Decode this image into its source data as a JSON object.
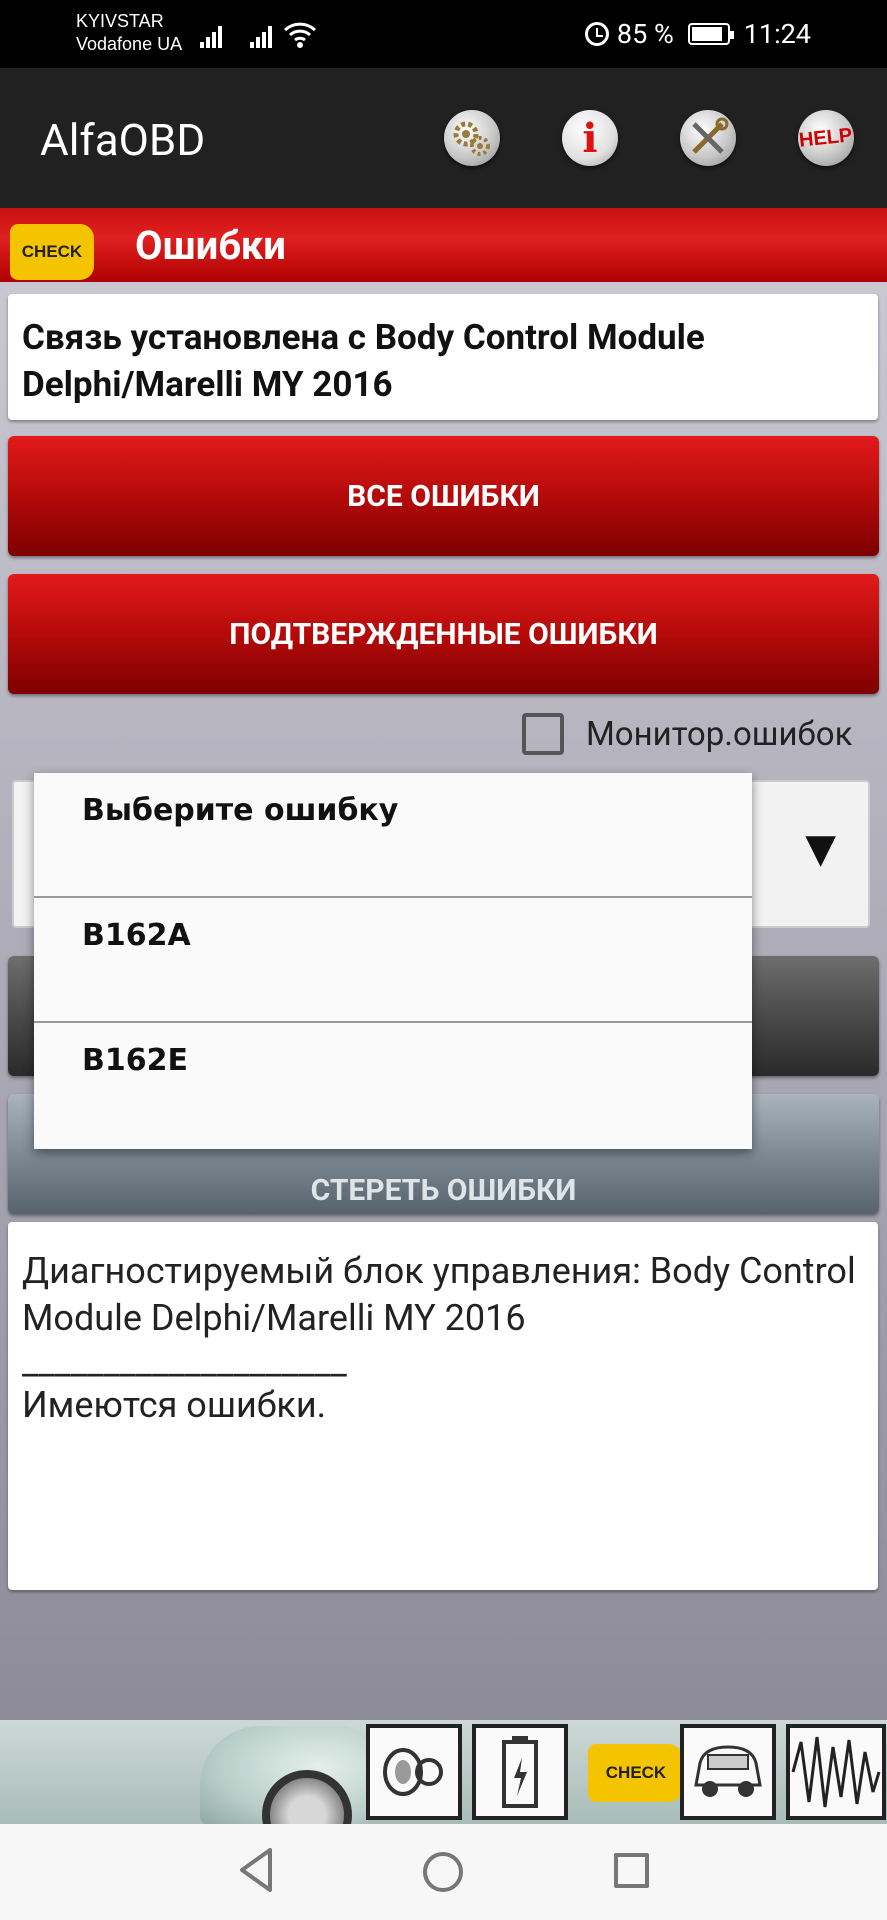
{
  "status_bar": {
    "carrier_1": "KYIVSTAR",
    "carrier_2": "Vodafone UA",
    "battery_percent": "85 %",
    "time": "11:24"
  },
  "app_bar": {
    "title": "AlfaOBD",
    "help_label": "HELP"
  },
  "section": {
    "title": "Ошибки",
    "check_label": "CHECK"
  },
  "connection": {
    "text": " Связь установлена с Body Control Module Delphi/Marelli MY 2016"
  },
  "buttons": {
    "all_errors": "ВСЕ ОШИБКИ",
    "confirmed_errors": "ПОДТВЕРЖДЕННЫЕ ОШИБКИ",
    "clear_errors": "СТЕРЕТЬ ОШИБКИ"
  },
  "monitor": {
    "label": "Монитор.ошибок",
    "checked": false
  },
  "dropdown": {
    "items": [
      "Выберите ошибку",
      "B162A",
      "B162E"
    ]
  },
  "log": {
    "line1": "Диагностируемый блок управления: Body Control Module Delphi/Marelli MY 2016",
    "separator": "____________________",
    "line2": "Имеются ошибки."
  },
  "bottom_bar": {
    "check_label": "CHECK"
  },
  "colors": {
    "red_accent": "#c81010",
    "check_yellow": "#f5c400",
    "app_bar": "#212121"
  }
}
